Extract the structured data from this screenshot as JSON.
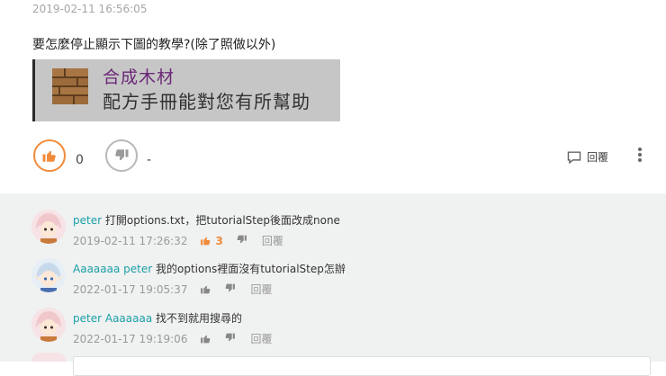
{
  "post": {
    "timestamp": "2019-02-11 16:56:05",
    "question": "要怎麼停止顯示下圖的教學?(除了照做以外)",
    "tutorial_image": {
      "title": "合成木材",
      "body": "配方手冊能對您有所幫助"
    },
    "likes": "0",
    "dislikes": "-",
    "reply_label": "回覆"
  },
  "comments": [
    {
      "author": "peter",
      "mention": "",
      "text": " 打開options.txt，把tutorialStep後面改成none",
      "time": "2019-02-11 17:26:32",
      "likes": "3",
      "reply_label": "回覆"
    },
    {
      "author": "Aaaaaaa",
      "mention": "peter",
      "text": " 我的options裡面沒有tutorialStep怎辦",
      "time": "2022-01-17 19:05:37",
      "likes": "",
      "reply_label": "回覆"
    },
    {
      "author": "peter",
      "mention": "Aaaaaaa",
      "text": " 找不到就用搜尋的",
      "time": "2022-01-17 19:19:06",
      "likes": "",
      "reply_label": "回覆"
    }
  ],
  "colors": {
    "accent": "#f08b3a",
    "author": "#1aa0a8",
    "tutorial_title": "#6b2878"
  }
}
